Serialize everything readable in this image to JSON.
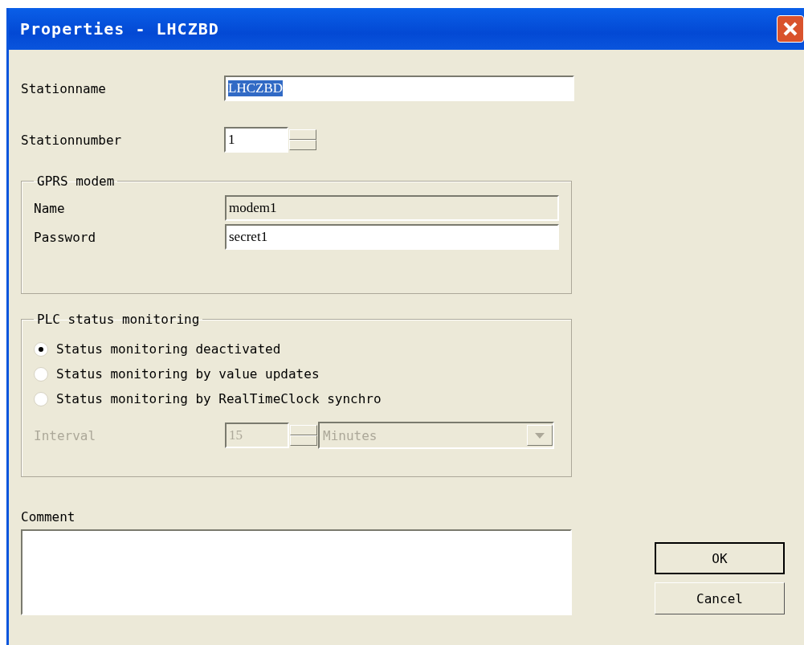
{
  "window": {
    "title": "Properties - LHCZBD"
  },
  "stationname": {
    "label": "Stationname",
    "value": "LHCZBD",
    "selected": true
  },
  "stationnumber": {
    "label": "Stationnumber",
    "value": "1"
  },
  "gprs_modem": {
    "title": "GPRS modem",
    "fields": [
      {
        "label": "Name",
        "value": "modem1",
        "disabled": true
      },
      {
        "label": "Password",
        "value": "secret1",
        "disabled": false
      }
    ]
  },
  "plc_status_monitoring": {
    "title": "PLC status monitoring",
    "options": [
      {
        "label": "Status monitoring deactivated",
        "selected": true
      },
      {
        "label": "Status monitoring by value updates",
        "selected": false
      },
      {
        "label": "Status monitoring by RealTimeClock synchro",
        "selected": false
      }
    ],
    "interval": {
      "label": "Interval",
      "value": "15",
      "unit": "Minutes",
      "disabled": true
    }
  },
  "comment": {
    "label": "Comment"
  },
  "buttons": [
    {
      "label": "OK",
      "default": true
    },
    {
      "label": "Cancel",
      "default": false
    }
  ]
}
